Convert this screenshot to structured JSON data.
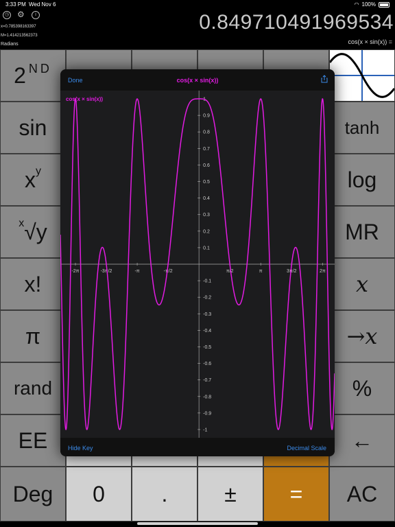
{
  "status": {
    "time": "3:33 PM",
    "date": "Wed Nov 6",
    "battery": "100%"
  },
  "display": {
    "memory_x": "x=0.785398163397",
    "memory_m": "M=1.414213562373",
    "angle_mode": "Radians",
    "result": "0.849710491969534",
    "expression": "cos(x × sin(x)) ="
  },
  "icons": {
    "history": "clock-icon",
    "settings": "gear-icon",
    "info": "info-icon",
    "share": "share-icon"
  },
  "keys": {
    "second": "2",
    "second_sup": "ND",
    "sin": "sin",
    "tanh": "tanh",
    "power": "x",
    "power_sup": "y",
    "log": "log",
    "root_sup": "x",
    "root": "√y",
    "mr": "MR",
    "factorial": "x!",
    "x_var": "x",
    "pi": "π",
    "store_x": "→x",
    "rand": "rand",
    "percent": "%",
    "ee": "EE",
    "backspace": "←",
    "deg": "Deg",
    "zero": "0",
    "dot": ".",
    "plusminus": "±",
    "equals": "=",
    "ac": "AC"
  },
  "graph": {
    "done": "Done",
    "title": "cos(x × sin(x))",
    "hide_key": "Hide Key",
    "decimal_scale": "Decimal Scale",
    "key_label": "cos(x × sin(x))"
  },
  "chart_data": {
    "type": "line",
    "title": "cos(x × sin(x))",
    "function": "cos(x*sin(x))",
    "xlim": [
      -7.05,
      6.9
    ],
    "ylim": [
      -1.05,
      1.05
    ],
    "x_ticks": [
      "-2π",
      "-3π/2",
      "-π",
      "-π/2",
      "π/2",
      "π",
      "3π/2",
      "2π"
    ],
    "y_ticks": [
      "1",
      "0.9",
      "0.8",
      "0.7",
      "0.6",
      "0.5",
      "0.4",
      "0.3",
      "0.2",
      "0.1",
      "0",
      "-0.1",
      "-0.2",
      "-0.3",
      "-0.4",
      "-0.5",
      "-0.6",
      "-0.7",
      "-0.8",
      "-0.9",
      "-1"
    ],
    "series": [
      {
        "name": "cos(x × sin(x))",
        "color": "#e21be2"
      }
    ],
    "grid": false
  },
  "colors": {
    "accent": "#3b8bea",
    "plot": "#e21be2",
    "orange_key": "#bd7914"
  }
}
